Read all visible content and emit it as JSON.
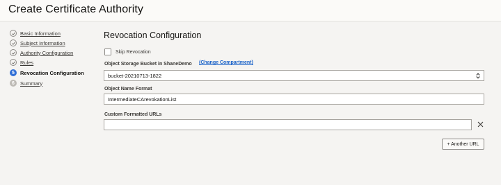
{
  "page": {
    "title": "Create Certificate Authority"
  },
  "steps": [
    {
      "label": "Basic Information",
      "state": "done",
      "number": ""
    },
    {
      "label": "Subject Information",
      "state": "done",
      "number": ""
    },
    {
      "label": "Authority Configuration",
      "state": "done",
      "number": ""
    },
    {
      "label": "Rules",
      "state": "done",
      "number": ""
    },
    {
      "label": "Revocation Configuration",
      "state": "current",
      "number": "5"
    },
    {
      "label": "Summary",
      "state": "pending",
      "number": "6"
    }
  ],
  "section": {
    "title": "Revocation Configuration"
  },
  "skip_revocation": {
    "label": "Skip Revocation",
    "checked": false
  },
  "bucket": {
    "label": "Object Storage Bucket in ShaneDemo",
    "change_link": "(Change Compartment)",
    "value": "bucket-20210713-1822"
  },
  "object_name": {
    "label": "Object Name Format",
    "value": "IntermediateCArevokationList"
  },
  "custom_urls": {
    "label": "Custom Formatted URLs",
    "value": ""
  },
  "add_url_button": {
    "label": "+ Another URL"
  },
  "colors": {
    "accent": "#2f6ed6",
    "link": "#1a62c8",
    "background": "#f5f4f2"
  }
}
